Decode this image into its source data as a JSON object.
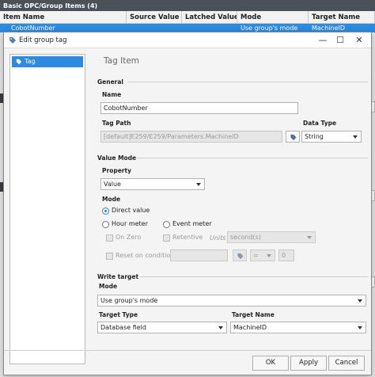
{
  "background": {
    "panel_title": "Basic OPC/Group Items (4)",
    "columns": [
      "Item Name",
      "Source Value",
      "Latched Value",
      "Mode",
      "Target Name"
    ],
    "selected_row": [
      "CobotNumber",
      "",
      "",
      "Use group's mode",
      "MachineID"
    ]
  },
  "dialog": {
    "title": "Edit group tag",
    "window_buttons": {
      "minimize": "—",
      "maximize": "☐",
      "close": "✕"
    },
    "left_items": [
      "Tag"
    ],
    "header": "Tag Item",
    "general": {
      "section": "General",
      "name_label": "Name",
      "name_value": "CobotNumber",
      "tag_path_label": "Tag Path",
      "tag_path_value": "[default]E259/E259/Parameters.MachineID",
      "data_type_label": "Data Type",
      "data_type_value": "String"
    },
    "value_mode": {
      "section": "Value Mode",
      "property_label": "Property",
      "property_value": "Value",
      "mode_label": "Mode",
      "direct_value": "Direct value",
      "hour_meter": "Hour meter",
      "event_meter": "Event meter",
      "on_zero": "On Zero",
      "retentive": "Retentive",
      "units_label": "Units",
      "units_value": "second(s)",
      "reset_on_condition": "Reset on condition:",
      "operator_value": "=",
      "reset_number": "0"
    },
    "write_target": {
      "section": "Write target",
      "mode_label": "Mode",
      "mode_value": "Use group's mode",
      "target_type_label": "Target Type",
      "target_type_value": "Database field",
      "target_name_label": "Target Name",
      "target_name_value": "MachineID"
    },
    "buttons": {
      "ok": "OK",
      "apply": "Apply",
      "cancel": "Cancel"
    }
  },
  "colors": {
    "accent": "#2d8ae0",
    "titlebar": "#4a5159"
  }
}
